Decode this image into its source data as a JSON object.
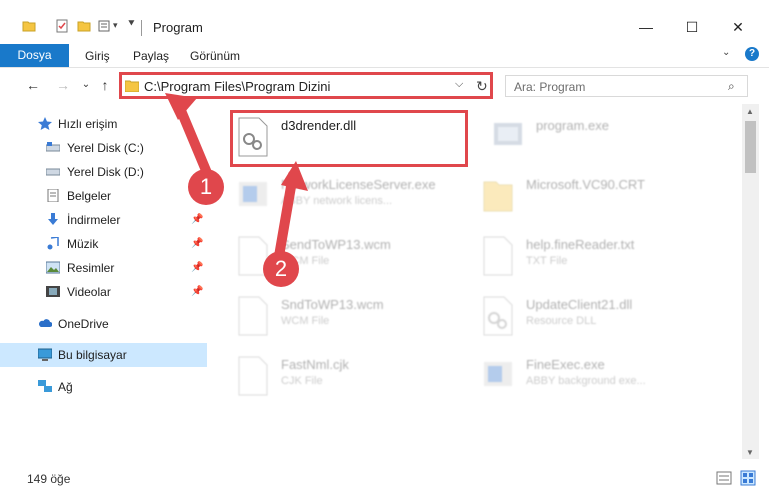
{
  "window": {
    "title": "Program",
    "minimize": "—",
    "maximize": "☐",
    "close": "✕"
  },
  "ribbon": {
    "tabs": [
      "Dosya",
      "Giriş",
      "Paylaş",
      "Görünüm"
    ],
    "help": "?"
  },
  "nav": {
    "back": "←",
    "forward": "→",
    "recent": "⌄",
    "up": "↑",
    "address": "C:\\Program Files\\Program Dizini",
    "refresh": "↻",
    "search_placeholder": "Ara: Program"
  },
  "sidebar": {
    "items": [
      {
        "label": "Hızlı erişim"
      },
      {
        "label": "Yerel Disk (C:)"
      },
      {
        "label": "Yerel Disk (D:)"
      },
      {
        "label": "Belgeler"
      },
      {
        "label": "İndirmeler"
      },
      {
        "label": "Müzik"
      },
      {
        "label": "Resimler"
      },
      {
        "label": "Videolar"
      },
      {
        "label": "OneDrive"
      },
      {
        "label": "Bu bilgisayar"
      },
      {
        "label": "Ağ"
      }
    ]
  },
  "files": [
    {
      "name": "d3drender.dll",
      "desc": ""
    },
    {
      "name": "program.exe",
      "desc": ""
    },
    {
      "name": "NetworkLicenseServer.exe",
      "desc": "ABBY network licens..."
    },
    {
      "name": "Microsoft.VC90.CRT",
      "desc": ""
    },
    {
      "name": "SendToWP13.wcm",
      "desc": "WCM File"
    },
    {
      "name": "help.fineReader.txt",
      "desc": "TXT File"
    },
    {
      "name": "SndToWP13.wcm",
      "desc": "WCM File"
    },
    {
      "name": "UpdateClient21.dll",
      "desc": "Resource DLL"
    },
    {
      "name": "FastNml.cjk",
      "desc": "CJK File"
    },
    {
      "name": "FineExec.exe",
      "desc": "ABBY background exe..."
    }
  ],
  "annotations": {
    "badge1": "1",
    "badge2": "2"
  },
  "status": {
    "count": "149 öğe"
  },
  "colors": {
    "accent": "#1979ca",
    "highlight": "#e0474c",
    "selection": "#cce8ff"
  }
}
